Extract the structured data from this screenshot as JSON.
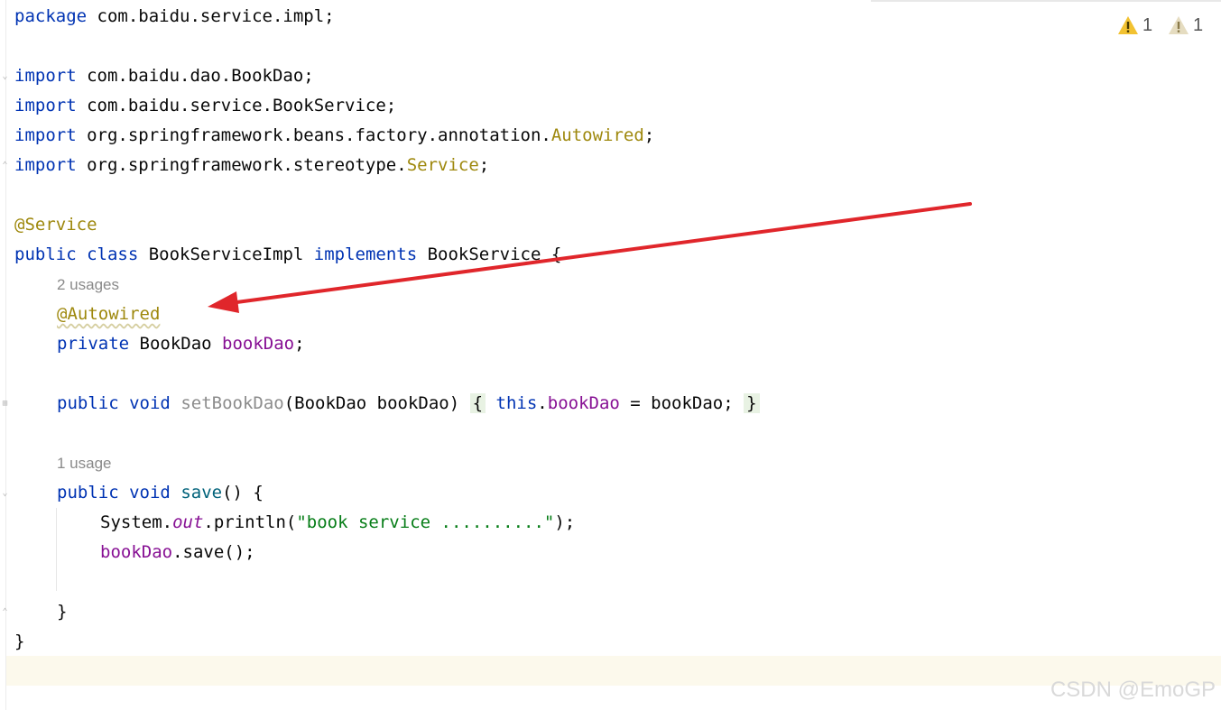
{
  "editor": {
    "lines": {
      "package": {
        "kw": "package",
        "rest": " com.baidu.service.impl;"
      },
      "import1": {
        "kw": "import",
        "rest": " com.baidu.dao.BookDao;"
      },
      "import2": {
        "kw": "import",
        "rest": " com.baidu.service.BookService;"
      },
      "import3": {
        "kw": "import",
        "rest": " org.springframework.beans.factory.annotation.",
        "ann": "Autowired",
        "tail": ";"
      },
      "import4": {
        "kw": "import",
        "rest": " org.springframework.stereotype.",
        "ann": "Service",
        "tail": ";"
      },
      "class_annotation": "@Service",
      "class_decl": {
        "kw1": "public",
        "kw2": "class",
        "name": " BookServiceImpl ",
        "kw3": "implements",
        "rest": " BookService {"
      },
      "field_usages": "2 usages",
      "field_annotation": "@Autowired",
      "field_decl": {
        "kw": "private",
        "type": " BookDao ",
        "name": "bookDao",
        "tail": ";"
      },
      "setter": {
        "kw1": "public",
        "kw2": "void",
        "name": "setBookDao",
        "params": "(BookDao bookDao)",
        "open": "{",
        "this": "this",
        "dot": ".",
        "field": "bookDao",
        "assign": " = bookDao;",
        "close": "}"
      },
      "save_usages": "1 usage",
      "save_decl": {
        "kw1": "public",
        "kw2": "void",
        "name": "save",
        "rest": "() {"
      },
      "println": {
        "obj": "System.",
        "static": "out",
        "call": ".println(",
        "str": "\"book service ..........\"",
        "tail": ");"
      },
      "dao_call": {
        "field": "bookDao",
        "rest": ".save();"
      },
      "method_close": "}",
      "class_close": "}"
    }
  },
  "warnings": {
    "errors_count": "1",
    "weak_count": "1"
  },
  "watermark": "CSDN @EmoGP",
  "colors": {
    "keyword": "#0033b3",
    "annotation": "#9e880d",
    "field": "#871094",
    "string": "#067d17",
    "arrow": "#e0262b"
  }
}
